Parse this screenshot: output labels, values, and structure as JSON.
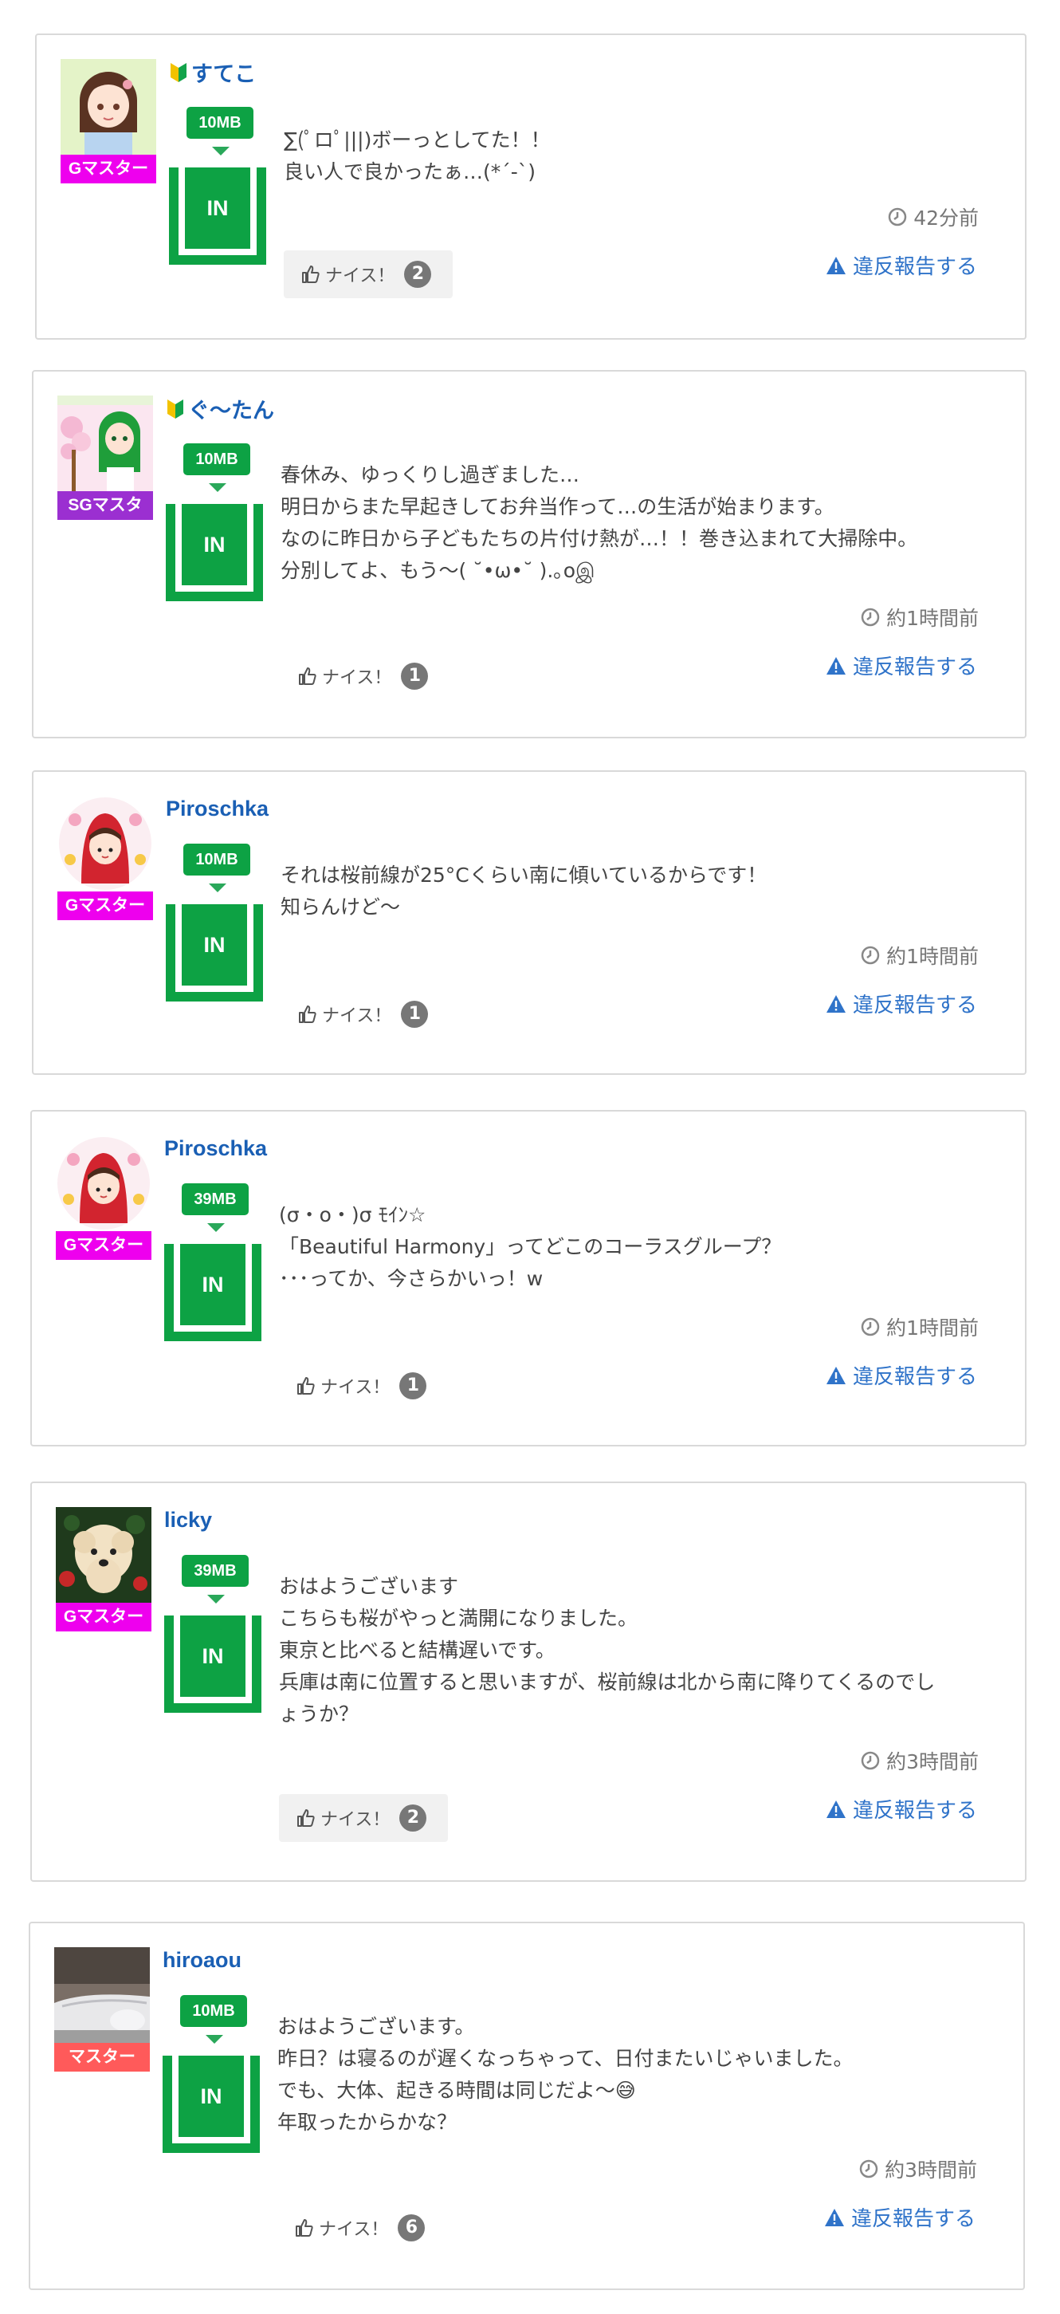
{
  "theme": {
    "link_color": "#1a5fb4",
    "capacity_color": "#0da244",
    "report_color": "#2f73c9",
    "rank_colors": {
      "Gマスター": "#ee00ee",
      "SGマスタ": "#9b2fd1",
      "マスター": "#ff5a5a"
    }
  },
  "posts": [
    {
      "user": "すてこ",
      "beginner": true,
      "avatar_icon": "anime-girl-avatar",
      "rank": "Gマスター",
      "capacity": "10MB",
      "in_label": "IN",
      "message": [
        "∑(ﾟロﾟ|||)ボーっとしてた！！",
        "良い人で良かったぁ…(*´-`)"
      ],
      "time": "42分前",
      "nice_label": "ナイス！",
      "nice_count": "2",
      "report_label": "違反報告する"
    },
    {
      "user": "ぐ〜たん",
      "beginner": true,
      "avatar_icon": "green-hair-girl-avatar",
      "rank": "SGマスタ",
      "capacity": "10MB",
      "in_label": "IN",
      "message": [
        "春休み、ゆっくりし過ぎました…",
        "明日からまた早起きしてお弁当作って…の生活が始まります。",
        "なのに昨日から子どもたちの片付け熱が…！！巻き込まれて大掃除中。",
        "分別してよ、もう〜( ˘•ω•˘ ).｡oஇ"
      ],
      "time": "約1時間前",
      "nice_label": "ナイス！",
      "nice_count": "1",
      "report_label": "違反報告する"
    },
    {
      "user": "Piroschka",
      "beginner": false,
      "avatar_icon": "red-hood-avatar",
      "rank": "Gマスター",
      "capacity": "10MB",
      "in_label": "IN",
      "message": [
        "それは桜前線が25°Cくらい南に傾いているからです！",
        "知らんけど〜"
      ],
      "time": "約1時間前",
      "nice_label": "ナイス！",
      "nice_count": "1",
      "report_label": "違反報告する"
    },
    {
      "user": "Piroschka",
      "beginner": false,
      "avatar_icon": "red-hood-avatar",
      "rank": "Gマスター",
      "capacity": "39MB",
      "in_label": "IN",
      "message": [
        "(σ・o・)σ ﾓｲﾝ☆",
        "「Beautiful Harmony」ってどこのコーラスグループ？",
        "･･･ってか、今さらかいっ！w"
      ],
      "time": "約1時間前",
      "nice_label": "ナイス！",
      "nice_count": "1",
      "report_label": "違反報告する"
    },
    {
      "user": "licky",
      "beginner": false,
      "avatar_icon": "dog-avatar",
      "rank": "Gマスター",
      "capacity": "39MB",
      "in_label": "IN",
      "message": [
        "おはようございます",
        "こちらも桜がやっと満開になりました。",
        "東京と比べると結構遅いです。",
        "兵庫は南に位置すると思いますが、桜前線は北から南に降りてくるのでし",
        "ょうか？"
      ],
      "time": "約3時間前",
      "nice_label": "ナイス！",
      "nice_count": "2",
      "report_label": "違反報告する"
    },
    {
      "user": "hiroaou",
      "beginner": false,
      "avatar_icon": "car-photo-avatar",
      "rank": "マスター",
      "capacity": "10MB",
      "in_label": "IN",
      "message": [
        "おはようございます。",
        "昨日？は寝るのが遅くなっちゃって、日付またいじゃいました。",
        "でも、大体、起きる時間は同じだよ〜😅",
        "年取ったからかな？"
      ],
      "time": "約3時間前",
      "nice_label": "ナイス！",
      "nice_count": "6",
      "report_label": "違反報告する"
    }
  ]
}
